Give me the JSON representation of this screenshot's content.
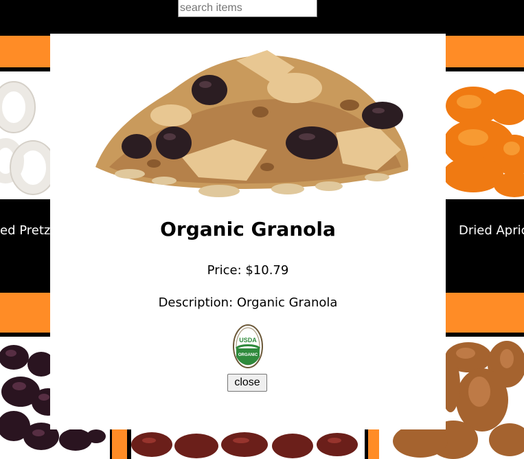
{
  "search": {
    "placeholder": "search items"
  },
  "background_tiles": [
    {
      "name": "ed Pretze",
      "image": "yogurt-pretzels"
    },
    {
      "name": "Dried Apric",
      "image": "dried-apricots"
    },
    {
      "image": "raisins"
    },
    {
      "image": "dried-cherries"
    },
    {
      "image": "almonds"
    }
  ],
  "modal": {
    "title": "Organic Granola",
    "price": "Price: $10.79",
    "description": "Description: Organic Granola",
    "badge": "USDA ORGANIC",
    "badge_top": "USDA",
    "badge_bottom": "ORGANIC",
    "close_label": "close"
  },
  "colors": {
    "accent": "#ff8c26",
    "background": "#000000",
    "modal": "#ffffff"
  }
}
